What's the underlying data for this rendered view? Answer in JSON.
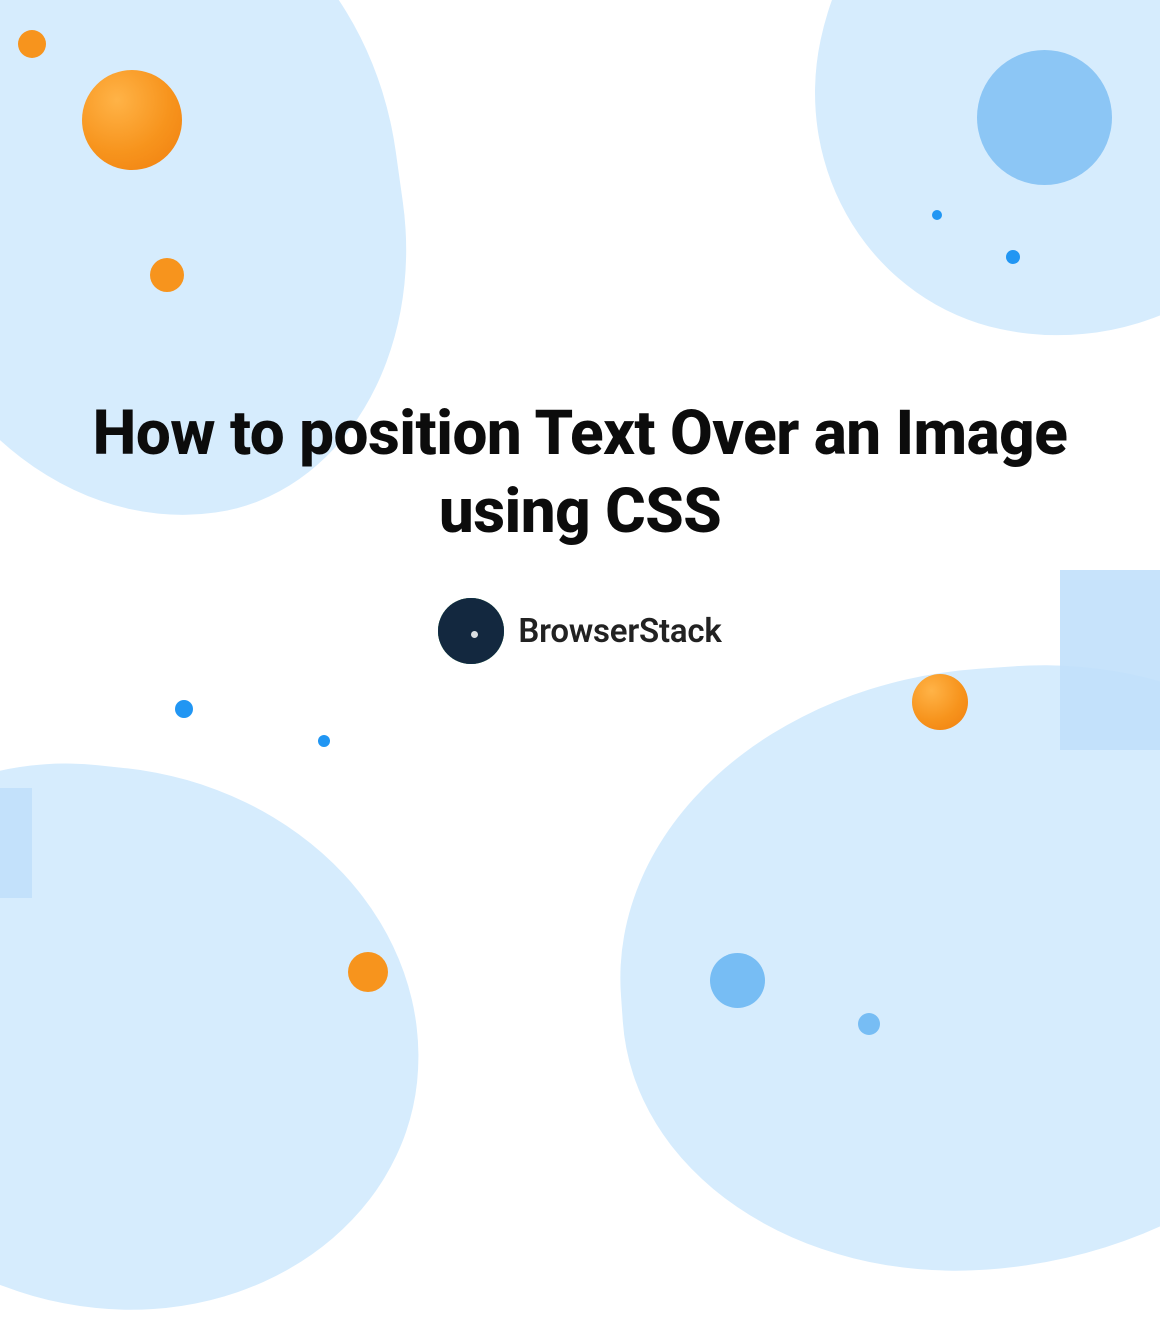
{
  "title": "How to position Text Over an Image using CSS",
  "brand": {
    "name": "BrowserStack"
  },
  "colors": {
    "bg_blob": "#d6ecfd",
    "orange": "#f7941d",
    "blue": "#8cc6f5",
    "text": "#0c0c0c"
  }
}
